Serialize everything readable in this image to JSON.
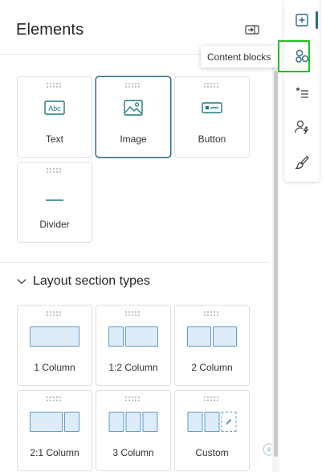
{
  "panel": {
    "title": "Elements",
    "collapse_icon": "collapse-panel-icon"
  },
  "elements": [
    {
      "label": "Text",
      "icon": "text-abc-icon",
      "selected": false
    },
    {
      "label": "Image",
      "icon": "image-icon",
      "selected": true
    },
    {
      "label": "Button",
      "icon": "button-icon",
      "selected": false
    },
    {
      "label": "Divider",
      "icon": "divider-icon",
      "selected": false
    }
  ],
  "layout_section": {
    "title": "Layout section types",
    "expanded": true,
    "items": [
      {
        "label": "1 Column"
      },
      {
        "label": "1:2 Column"
      },
      {
        "label": "2 Column"
      },
      {
        "label": "2:1 Column"
      },
      {
        "label": "3 Column"
      },
      {
        "label": "Custom"
      }
    ]
  },
  "rail": {
    "items": [
      {
        "name": "add-elements",
        "icon": "add-square-icon",
        "active": true
      },
      {
        "name": "content-blocks",
        "icon": "content-blocks-icon",
        "active": false,
        "highlighted": true
      },
      {
        "name": "personalization",
        "icon": "star-list-icon",
        "active": false
      },
      {
        "name": "dynamic-content",
        "icon": "person-lightning-icon",
        "active": false
      },
      {
        "name": "styles",
        "icon": "paintbrush-icon",
        "active": false
      }
    ]
  },
  "tooltip": {
    "text": "Content blocks"
  },
  "colors": {
    "accent": "#2b6a8a",
    "teal_icon": "#1a7a7a",
    "highlight_green": "#20c020",
    "column_fill": "#deecf9",
    "column_border": "#5b9bc8"
  }
}
